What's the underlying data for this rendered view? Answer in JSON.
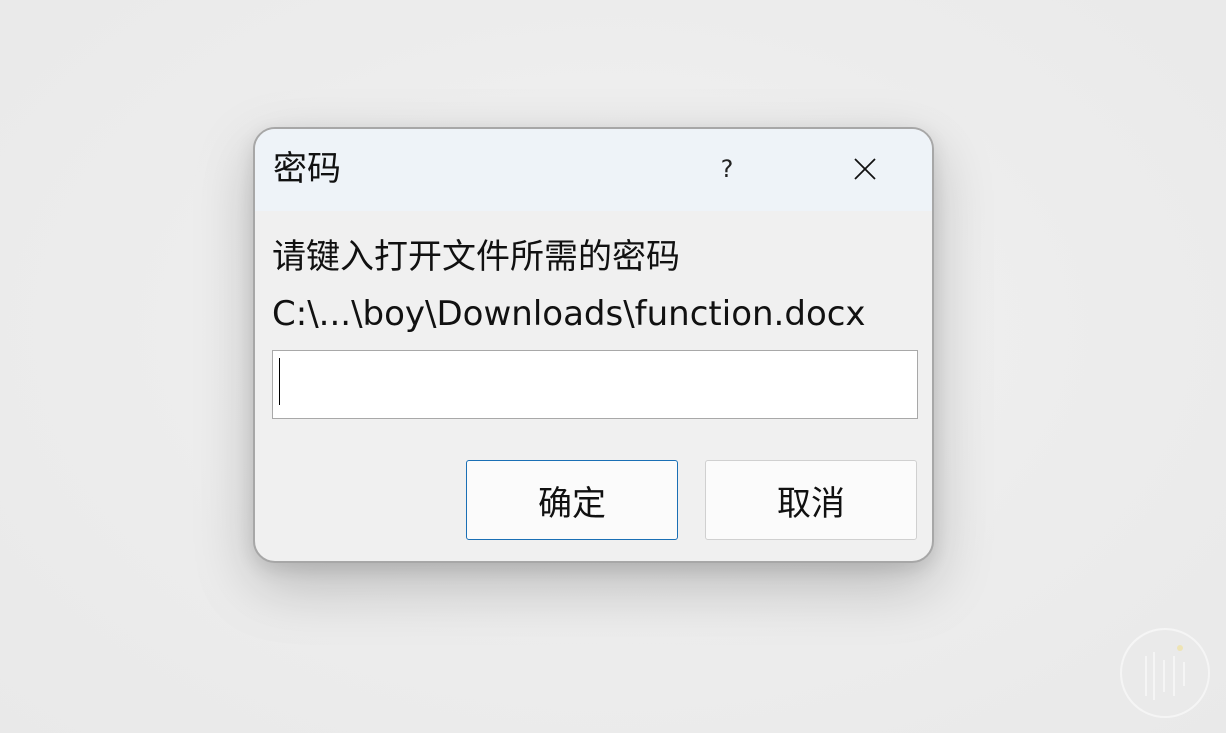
{
  "dialog": {
    "title": "密码",
    "help_label": "?",
    "close_icon": "close-icon",
    "prompt": "请键入打开文件所需的密码",
    "file_path": "C:\\...\\boy\\Downloads\\function.docx",
    "password_value": "",
    "ok_label": "确定",
    "cancel_label": "取消"
  },
  "colors": {
    "background": "#ececec",
    "dialog_bg": "#f0f0f0",
    "titlebar_bg": "#eef3f8",
    "default_button_border": "#1a6fb5"
  }
}
